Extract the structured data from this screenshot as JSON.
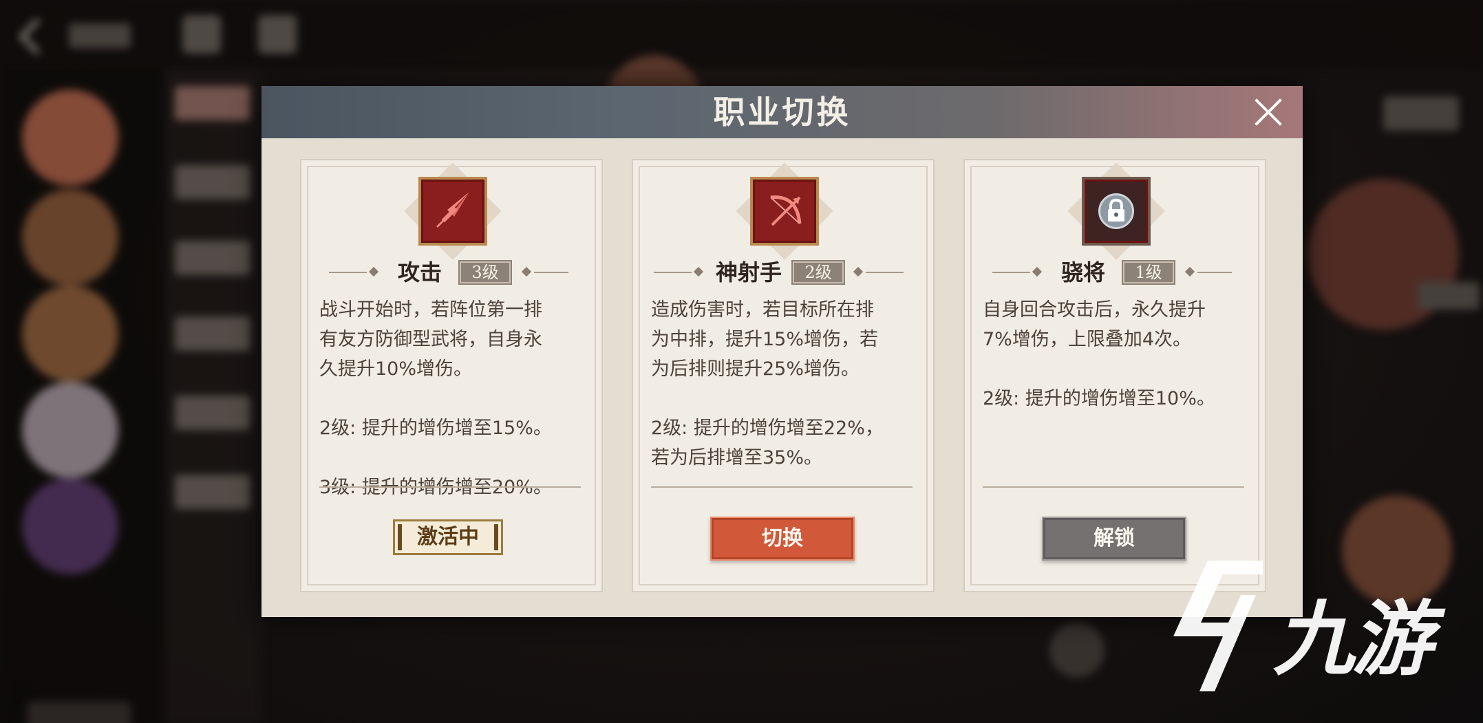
{
  "modal": {
    "title": "职业切换"
  },
  "cards": [
    {
      "name": "攻击",
      "level": "3级",
      "icon": "sword-icon",
      "desc": [
        "战斗开始时，若阵位第一排",
        "有友方防御型武将，自身永",
        "久提升10%增伤。",
        "",
        "2级: 提升的增伤增至15%。",
        "",
        "3级: 提升的增伤增至20%。"
      ],
      "status": "激活中"
    },
    {
      "name": "神射手",
      "level": "2级",
      "icon": "bow-icon",
      "desc": [
        "造成伤害时，若目标所在排",
        "为中排，提升15%增伤，若",
        "为后排则提升25%增伤。",
        "",
        "2级: 提升的增伤增至22%，",
        "若为后排增至35%。"
      ],
      "button": "切换"
    },
    {
      "name": "骁将",
      "level": "1级",
      "icon": "lock-icon",
      "desc": [
        "自身回合攻击后，永久提升",
        "7%增伤，上限叠加4次。",
        "",
        "2级: 提升的增伤增至10%。"
      ],
      "button": "解锁"
    }
  ],
  "watermark": {
    "text": "九游"
  },
  "colors": {
    "accent_button": "#d2583a",
    "locked_button": "#757170",
    "emblem_red": "#8a1d1d",
    "header_from": "#4a5560",
    "header_to": "#a67878"
  }
}
